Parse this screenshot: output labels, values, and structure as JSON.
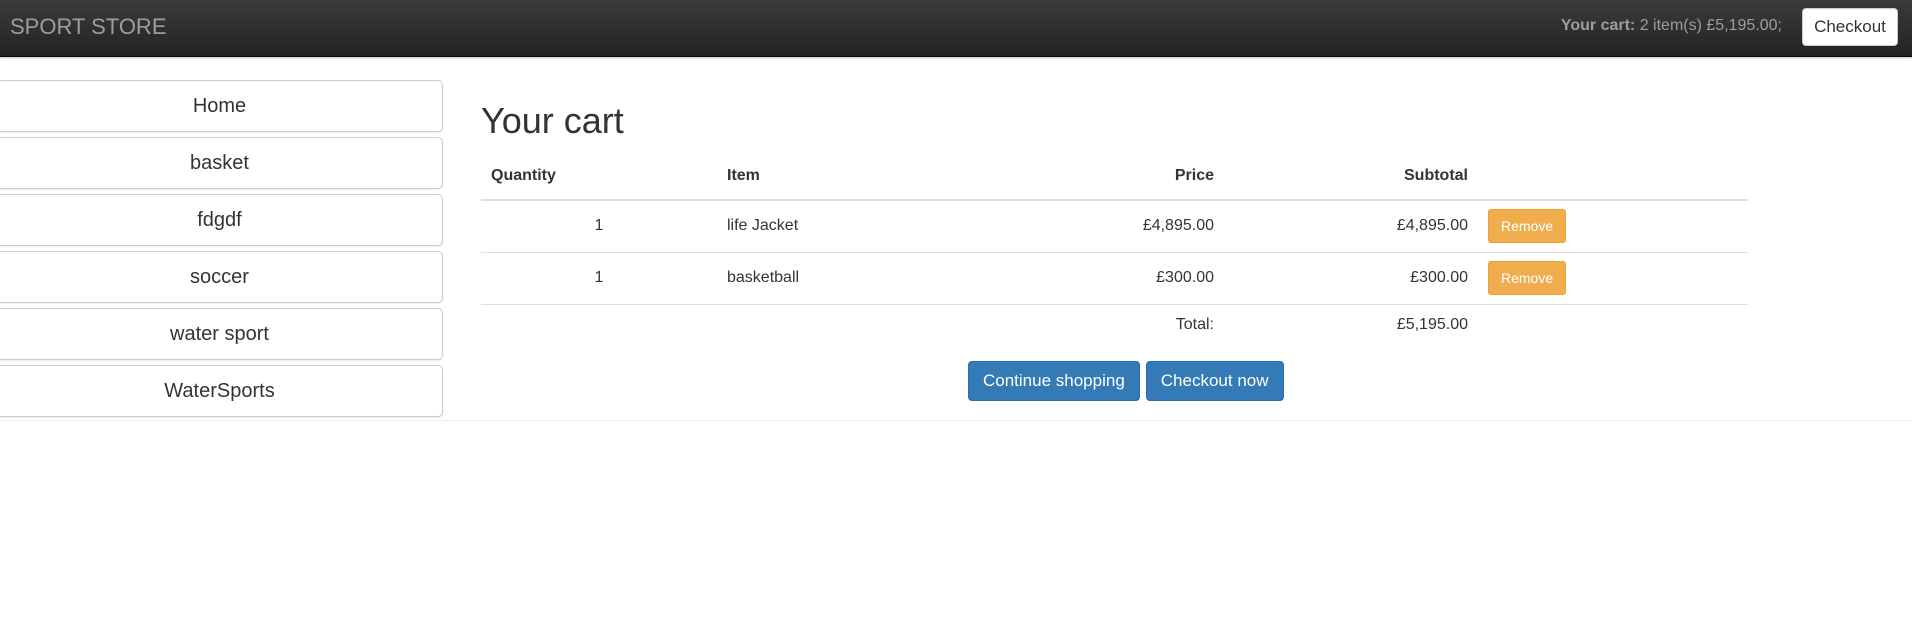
{
  "navbar": {
    "brand": "SPORT STORE",
    "cart_label": "Your cart:",
    "cart_summary": "2 item(s) £5,195.00;",
    "checkout_label": "Checkout"
  },
  "sidebar": {
    "items": [
      {
        "label": "Home"
      },
      {
        "label": "basket"
      },
      {
        "label": "fdgdf"
      },
      {
        "label": "soccer"
      },
      {
        "label": "water sport"
      },
      {
        "label": "WaterSports"
      }
    ]
  },
  "main": {
    "title": "Your cart",
    "table": {
      "headers": {
        "quantity": "Quantity",
        "item": "Item",
        "price": "Price",
        "subtotal": "Subtotal"
      },
      "rows": [
        {
          "quantity": "1",
          "item": "life Jacket",
          "price": "£4,895.00",
          "subtotal": "£4,895.00",
          "action": "Remove"
        },
        {
          "quantity": "1",
          "item": "basketball",
          "price": "£300.00",
          "subtotal": "£300.00",
          "action": "Remove"
        }
      ],
      "total_label": "Total:",
      "total_value": "£5,195.00"
    },
    "continue_label": "Continue shopping",
    "checkout_now_label": "Checkout now"
  },
  "colors": {
    "navbar": "#222222",
    "primary": "#337ab7",
    "warning": "#f0ad4e"
  }
}
